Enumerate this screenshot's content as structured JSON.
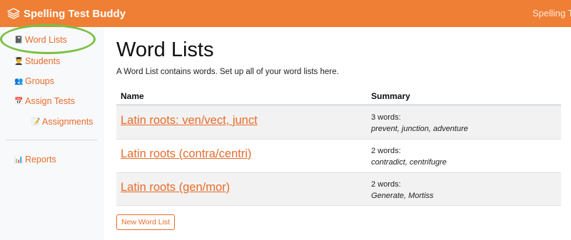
{
  "colors": {
    "brand": "#ef7f35",
    "link": "#e76c2b",
    "highlight": "#79c043"
  },
  "navbar": {
    "brand_icon": "stack-icon",
    "brand_name": "Spelling Test Buddy",
    "right_text": "Spelling Te"
  },
  "sidebar": {
    "items": [
      {
        "icon": "notebook-icon",
        "glyph": "📓",
        "label": "Word Lists"
      },
      {
        "icon": "student-icon",
        "glyph": "👨‍🎓",
        "label": "Students"
      },
      {
        "icon": "groups-icon",
        "glyph": "👥",
        "label": "Groups"
      },
      {
        "icon": "calendar-icon",
        "glyph": "📅",
        "label": "Assign Tests"
      },
      {
        "icon": "memo-icon",
        "glyph": "📝",
        "label": "Assignments"
      },
      {
        "icon": "bar-chart-icon",
        "glyph": "📊",
        "label": "Reports"
      }
    ]
  },
  "main": {
    "title": "Word Lists",
    "description": "A Word List contains words. Set up all of your word lists here.",
    "table": {
      "headers": {
        "name": "Name",
        "summary": "Summary"
      },
      "rows": [
        {
          "name": "Latin roots: ven/vect, junct",
          "count": "3 words:",
          "words": "prevent, junction, adventure"
        },
        {
          "name": "Latin roots (contra/centri)",
          "count": "2 words:",
          "words": "contradict, centrifugre"
        },
        {
          "name": "Latin roots (gen/mor)",
          "count": "2 words:",
          "words": "Generate, Mortiss"
        }
      ]
    },
    "new_button": "New Word List"
  }
}
